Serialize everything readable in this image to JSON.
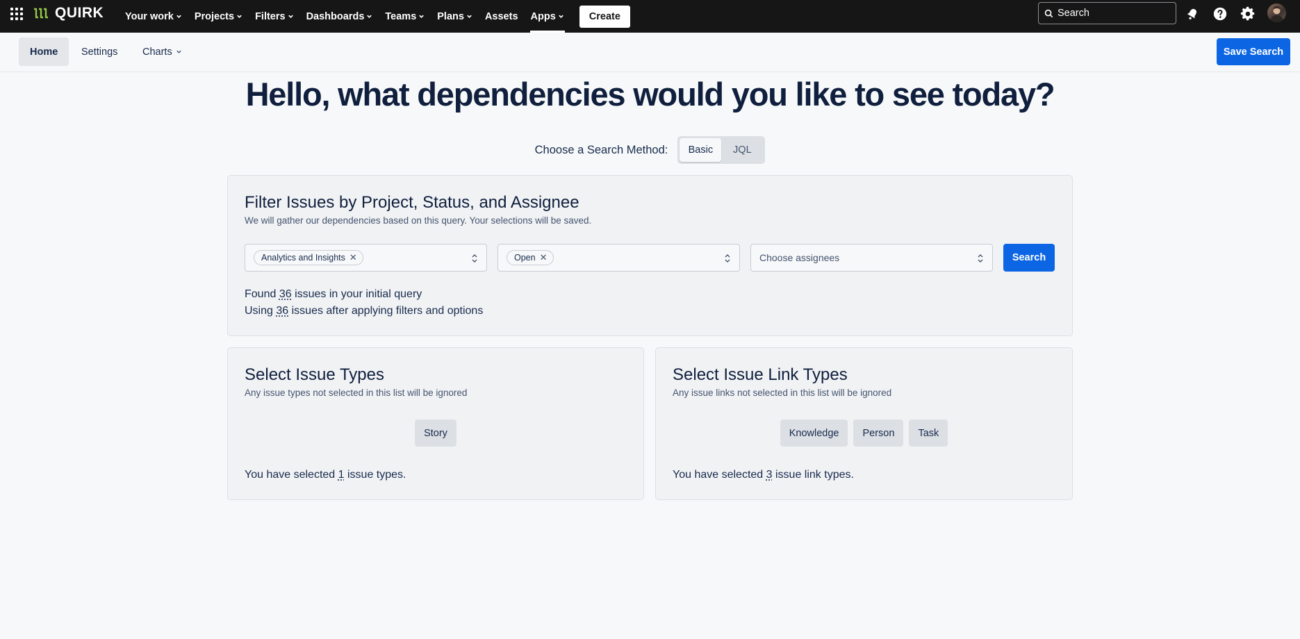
{
  "app": {
    "logo_text": "QUIRK"
  },
  "topnav": {
    "items": [
      {
        "label": "Your work",
        "has_menu": true
      },
      {
        "label": "Projects",
        "has_menu": true
      },
      {
        "label": "Filters",
        "has_menu": true
      },
      {
        "label": "Dashboards",
        "has_menu": true
      },
      {
        "label": "Teams",
        "has_menu": true
      },
      {
        "label": "Plans",
        "has_menu": true
      },
      {
        "label": "Assets",
        "has_menu": false
      },
      {
        "label": "Apps",
        "has_menu": true
      }
    ],
    "create_label": "Create",
    "search_placeholder": "Search"
  },
  "subnav": {
    "tabs": [
      {
        "label": "Home",
        "active": true
      },
      {
        "label": "Settings",
        "active": false
      },
      {
        "label": "Charts",
        "active": false
      }
    ],
    "save_label": "Save Search"
  },
  "hero": {
    "title": "Hello, what dependencies would you like to see today?",
    "method_label": "Choose a Search Method:",
    "methods": [
      {
        "label": "Basic",
        "active": true
      },
      {
        "label": "JQL",
        "active": false
      }
    ]
  },
  "filter_card": {
    "title": "Filter Issues by Project, Status, and Assignee",
    "subtitle": "We will gather our dependencies based on this query. Your selections will be saved.",
    "project_chip": "Analytics and Insights",
    "status_chip": "Open",
    "assignee_placeholder": "Choose assignees",
    "search_label": "Search",
    "found_pre": "Found",
    "found_count": "36",
    "found_post": "issues in your initial query",
    "using_pre": "Using",
    "using_count": "36",
    "using_post": "issues after applying filters and options"
  },
  "types_card": {
    "title": "Select Issue Types",
    "subtitle": "Any issue types not selected in this list will be ignored",
    "types": [
      "Story"
    ],
    "sel_pre": "You have selected",
    "sel_count": "1",
    "sel_post": "issue types."
  },
  "links_card": {
    "title": "Select Issue Link Types",
    "subtitle": "Any issue links not selected in this list will be ignored",
    "types": [
      "Knowledge",
      "Person",
      "Task"
    ],
    "sel_pre": "You have selected",
    "sel_count": "3",
    "sel_post": "issue link types."
  },
  "colors": {
    "topbar": "#161616",
    "primary": "#0c66e4",
    "heading": "#0f1f3d",
    "logo_green": "#94c748"
  }
}
